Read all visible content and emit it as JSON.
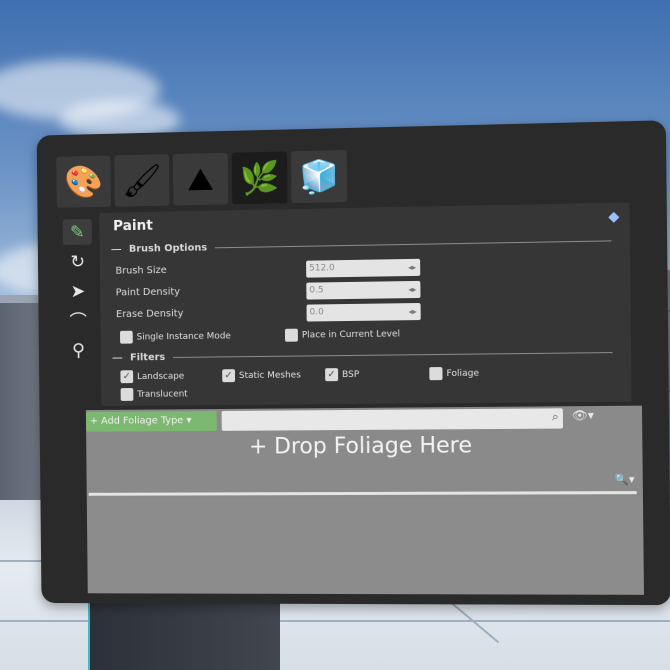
{
  "toolbar": {
    "tools": [
      {
        "icon": "place-icon",
        "glyph": "🎨"
      },
      {
        "icon": "paint-icon",
        "glyph": "🖌"
      },
      {
        "icon": "landscape-icon",
        "glyph": "⛰"
      },
      {
        "icon": "foliage-icon",
        "glyph": "🌿"
      },
      {
        "icon": "mesh-paint-icon",
        "glyph": "🧊"
      }
    ],
    "active_index": 3
  },
  "side_modes": [
    {
      "icon": "paint-mode-icon",
      "glyph": "✎"
    },
    {
      "icon": "reapply-mode-icon",
      "glyph": "↻"
    },
    {
      "icon": "select-mode-icon",
      "glyph": "➤"
    },
    {
      "icon": "lasso-mode-icon",
      "glyph": "⌒"
    },
    {
      "icon": "fill-mode-icon",
      "glyph": "⚲"
    }
  ],
  "mode": {
    "title": "Paint",
    "help_glyph": "◆"
  },
  "brush_options": {
    "header": "Brush Options",
    "brush_size_label": "Brush Size",
    "brush_size_value": "512.0",
    "paint_density_label": "Paint Density",
    "paint_density_value": "0.5",
    "erase_density_label": "Erase Density",
    "erase_density_value": "0.0",
    "single_instance_label": "Single Instance Mode",
    "place_in_level_label": "Place in Current Level"
  },
  "filters": {
    "header": "Filters",
    "landscape_label": "Landscape",
    "static_meshes_label": "Static Meshes",
    "bsp_label": "BSP",
    "foliage_label": "Foliage",
    "translucent_label": "Translucent",
    "landscape_checked": "✓",
    "static_meshes_checked": "✓",
    "bsp_checked": "✓"
  },
  "foliage_list": {
    "add_button_label": "+ Add Foliage Type ▾",
    "drop_text": "+ Drop Foliage Here",
    "view_options_glyph": "👁▾",
    "zoom_glyph": "🔍▾"
  }
}
